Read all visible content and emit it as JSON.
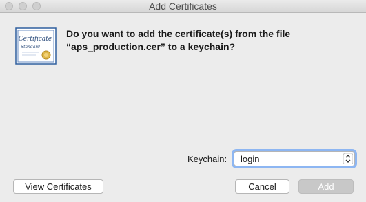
{
  "window": {
    "title": "Add Certificates"
  },
  "icon": {
    "name": "certificate-icon",
    "lettering": [
      "Certificate",
      "Standard"
    ]
  },
  "message": {
    "line1": "Do you want to add the certificate(s) from the file",
    "line2": "“aps_production.cer” to a keychain?"
  },
  "keychain": {
    "label": "Keychain:",
    "selected": "login"
  },
  "buttons": {
    "view_certificates": "View Certificates",
    "cancel": "Cancel",
    "add": "Add"
  },
  "colors": {
    "background": "#ececec",
    "focus_ring": "#8db6f2",
    "disabled_button": "#c8c8c8"
  }
}
